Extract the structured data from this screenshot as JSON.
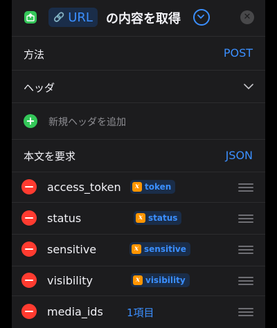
{
  "header": {
    "url_token": "URL",
    "title": "の内容を取得",
    "icons": [
      "shortcut-app-icon",
      "link-icon",
      "chevron-down-icon",
      "close-icon"
    ]
  },
  "method": {
    "label": "方法",
    "value": "POST"
  },
  "headers": {
    "label": "ヘッダ"
  },
  "add_header": {
    "label": "新規ヘッダを追加"
  },
  "body": {
    "label": "本文を要求",
    "value": "JSON"
  },
  "fields": [
    {
      "key": "access_token",
      "value": "token",
      "type": "variable"
    },
    {
      "key": "status",
      "value": "status",
      "type": "variable"
    },
    {
      "key": "sensitive",
      "value": "sensitive",
      "type": "variable"
    },
    {
      "key": "visibility",
      "value": "visibility",
      "type": "variable"
    },
    {
      "key": "media_ids",
      "value": "1項目",
      "type": "text"
    }
  ],
  "colors": {
    "background": "#1c1c1e",
    "accent": "#3b8fff",
    "add": "#34c759",
    "remove": "#ff3b30",
    "variable_badge": "#ff9500"
  }
}
